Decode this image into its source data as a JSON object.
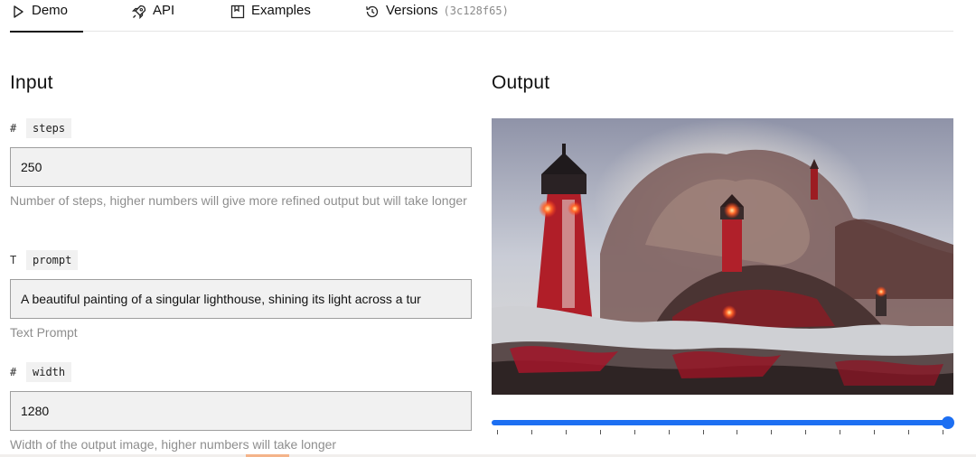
{
  "tabs": [
    {
      "label": "Demo",
      "icon": "play-icon",
      "active": true
    },
    {
      "label": "API",
      "icon": "rocket-icon"
    },
    {
      "label": "Examples",
      "icon": "bookmark-icon"
    },
    {
      "label": "Versions",
      "icon": "history-icon",
      "hash": "(3c128f65)"
    }
  ],
  "input": {
    "title": "Input",
    "fields": [
      {
        "type_symbol": "#",
        "name": "steps",
        "value": "250",
        "help": "Number of steps, higher numbers will give more refined output but will take longer"
      },
      {
        "type_symbol": "T",
        "name": "prompt",
        "value": "A beautiful painting of a singular lighthouse, shining its light across a tur",
        "help": "Text Prompt"
      },
      {
        "type_symbol": "#",
        "name": "width",
        "value": "1280",
        "help": "Width of the output image, higher numbers will take longer"
      }
    ]
  },
  "output": {
    "title": "Output",
    "image_subject": "painting of red lighthouses amid crashing waves",
    "slider_position": 1.0,
    "slider_ticks": 14
  },
  "colors": {
    "accent": "#1d6ff2",
    "input_bg": "#f1f1f1",
    "help_text": "#8e8e8e"
  }
}
